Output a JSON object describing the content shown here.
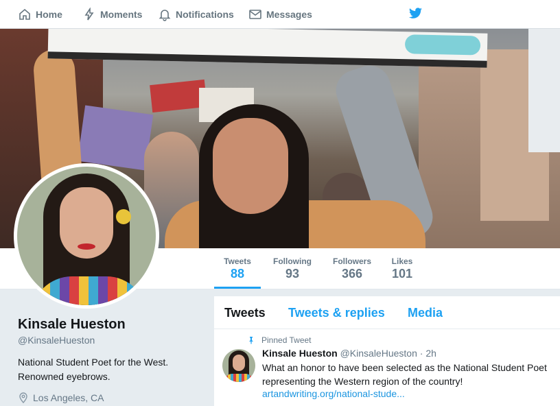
{
  "nav": {
    "home": "Home",
    "moments": "Moments",
    "notifications": "Notifications",
    "messages": "Messages"
  },
  "icons": {
    "home": "home-icon",
    "moments": "lightning-icon",
    "notifications": "bell-icon",
    "messages": "envelope-icon",
    "brand": "twitter-bird-icon",
    "location": "map-pin-icon",
    "pinned": "pin-icon"
  },
  "colors": {
    "accent": "#1da1f2",
    "link": "#1b95e0",
    "muted": "#657786"
  },
  "stats": {
    "tweets": {
      "label": "Tweets",
      "value": "88"
    },
    "following": {
      "label": "Following",
      "value": "93"
    },
    "followers": {
      "label": "Followers",
      "value": "366"
    },
    "likes": {
      "label": "Likes",
      "value": "101"
    }
  },
  "profile": {
    "name": "Kinsale Hueston",
    "handle": "@KinsaleHueston",
    "bio": "National Student Poet for the West. Renowned eyebrows.",
    "location": "Los Angeles, CA"
  },
  "timeline": {
    "tabs": [
      "Tweets",
      "Tweets & replies",
      "Media"
    ],
    "active_tab": "Tweets",
    "tweet": {
      "pinned_label": "Pinned Tweet",
      "name": "Kinsale Hueston",
      "handle": "@KinsaleHueston",
      "dot": "·",
      "time": "2h",
      "text": "What an honor to have been selected as the National Student Poet representing the Western region of the country!",
      "link": "artandwriting.org/national-stude..."
    }
  }
}
